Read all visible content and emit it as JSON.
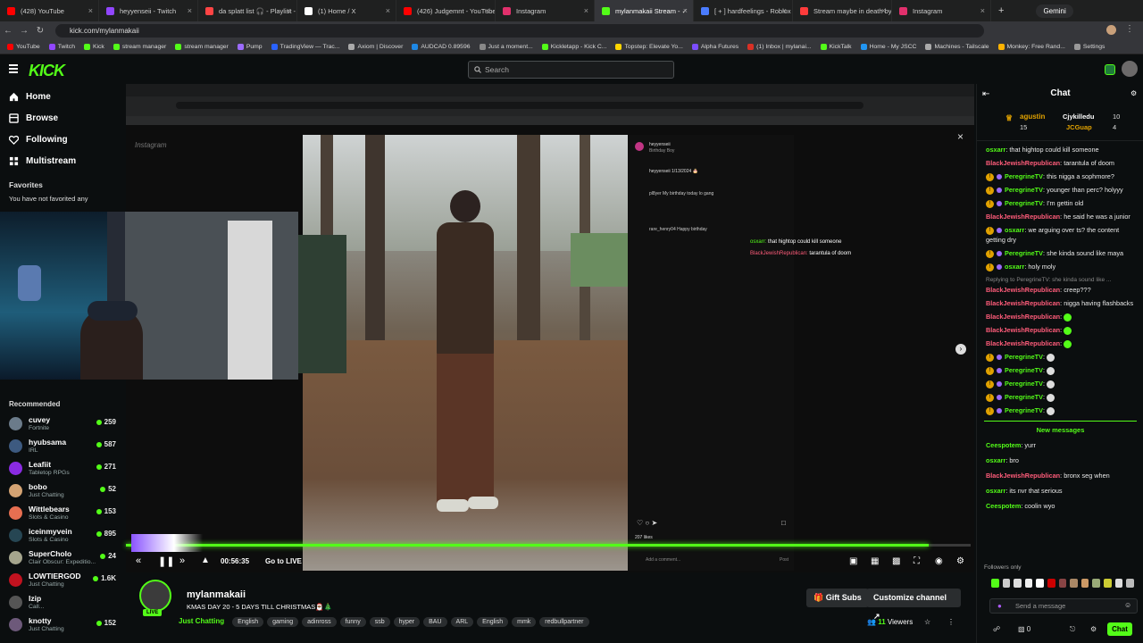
{
  "browser": {
    "tabs": [
      {
        "label": "(428) YouTube",
        "color": "#ff0000"
      },
      {
        "label": "heyyenseii - Twitch",
        "color": "#9146ff"
      },
      {
        "label": "da splatt list 🎧 - Playlist - A",
        "color": "#ff4444"
      },
      {
        "label": "(1) Home / X",
        "color": "#ffffff"
      },
      {
        "label": "(426) Judgemnt - YouTube",
        "color": "#ff0000"
      },
      {
        "label": "Instagram",
        "color": "#e1306c"
      },
      {
        "label": "mylanmakaii Stream - ✓",
        "color": "#53fc18"
      },
      {
        "label": "[ + ] hardfeelings - Roblox",
        "color": "#4a7cff"
      },
      {
        "label": "Stream maybe in death by C",
        "color": "#ff3b3b"
      },
      {
        "label": "Instagram",
        "color": "#e1306c"
      }
    ],
    "active_tab": 6,
    "profile_label": "Gemini",
    "url": "kick.com/mylanmakaii",
    "bookmarks": [
      "YouTube",
      "Twitch",
      "Kick",
      "stream manager",
      "stream manager",
      "Pump",
      "TradingView — Trac...",
      "Axiom | Discover",
      "AUDCAD 0.89596",
      "Just a moment...",
      "Kickletapp - Kick C...",
      "Topstep: Elevate Yo...",
      "Alpha Futures",
      "(1) Inbox | mylanai...",
      "KickTalk",
      "Home - My JSCC",
      "Machines - Tailscale",
      "Monkey: Free Rand...",
      "Settings"
    ]
  },
  "kick": {
    "logo": "KICK",
    "search_placeholder": "Search"
  },
  "sidebar": {
    "nav": [
      {
        "label": "Home",
        "icon": "home-icon"
      },
      {
        "label": "Browse",
        "icon": "browse-icon"
      },
      {
        "label": "Following",
        "icon": "heart-icon"
      },
      {
        "label": "Multistream",
        "icon": "multistream-icon"
      }
    ],
    "favorites_title": "Favorites",
    "favorites_empty": "You have not favorited any",
    "recommended_title": "Recommended",
    "recommended": [
      {
        "name": "cuvey",
        "category": "Fortnite",
        "viewers": "259",
        "color": "#6b7b8a"
      },
      {
        "name": "hyubsama",
        "category": "IRL",
        "viewers": "587",
        "color": "#3d5a80"
      },
      {
        "name": "Leafiit",
        "category": "Tabletop RPGs",
        "viewers": "271",
        "color": "#8a2be2"
      },
      {
        "name": "bobo",
        "category": "Just Chatting",
        "viewers": "52",
        "color": "#d4a373"
      },
      {
        "name": "Wittlebears",
        "category": "Slots & Casino",
        "viewers": "153",
        "color": "#e76f51"
      },
      {
        "name": "iceinmyvein",
        "category": "Slots & Casino",
        "viewers": "895",
        "color": "#264653"
      },
      {
        "name": "SuperChoIo",
        "category": "Clair Obscur: Expeditio...",
        "viewers": "24",
        "color": "#a5a58d"
      },
      {
        "name": "LOWTIERGOD",
        "category": "Just Chatting",
        "viewers": "1.6K",
        "color": "#c1121f"
      },
      {
        "name": "Izip",
        "category": "Call...",
        "viewers": "",
        "color": "#555555"
      },
      {
        "name": "knotty",
        "category": "Just Chatting",
        "viewers": "152",
        "color": "#6d597a"
      }
    ]
  },
  "player": {
    "time": "00:56:35",
    "go_live": "Go to LIVE",
    "progress": 0.95
  },
  "stream_info": {
    "channel": "mylanmakaii",
    "title": "KMAS DAY 20 - 5 DAYS TILL CHRISTMAS🎅🏾🎄",
    "live_badge": "LIVE",
    "category": "Just Chatting",
    "tags": [
      "English",
      "gaming",
      "adinross",
      "funny",
      "ssb",
      "hyper",
      "BAU",
      "ARL",
      "English",
      "mmk",
      "redbullpartner"
    ],
    "viewers": "11",
    "viewers_label": "Viewers",
    "gift_subs": "Gift Subs",
    "customize": "Customize channel"
  },
  "chat": {
    "title": "Chat",
    "top_gifters": [
      {
        "name": "agustin",
        "count": "15"
      },
      {
        "name": "Cjykilledu",
        "count": "10"
      },
      {
        "name": "JCGuap",
        "count": "4"
      }
    ],
    "messages": [
      {
        "user": "osxarr",
        "color": "#53fc18",
        "badge": false,
        "text": "that hightop could kill someone"
      },
      {
        "user": "BlackJewishRepublican",
        "color": "#ff5c7a",
        "badge": false,
        "text": "tarantula of doom"
      },
      {
        "user": "PeregrineTV",
        "color": "#53fc18",
        "badge": true,
        "text": "this nigga a sophmore?"
      },
      {
        "user": "PeregrineTV",
        "color": "#53fc18",
        "badge": true,
        "text": "younger than perc? holyyy"
      },
      {
        "user": "PeregrineTV",
        "color": "#53fc18",
        "badge": true,
        "text": "I'm gettin old"
      },
      {
        "user": "BlackJewishRepublican",
        "color": "#ff5c7a",
        "badge": false,
        "text": "he said he was a junior"
      },
      {
        "user": "osxarr",
        "color": "#53fc18",
        "badge": true,
        "text": "we arguing over ts? the content getting dry"
      },
      {
        "user": "PeregrineTV",
        "color": "#53fc18",
        "badge": true,
        "text": "she kinda sound like maya"
      },
      {
        "user": "osxarr",
        "color": "#53fc18",
        "badge": true,
        "text": "holy moly"
      },
      {
        "user": "BlackJewishRepublican",
        "color": "#ff5c7a",
        "badge": false,
        "text": "creep???",
        "reply": "Replying to PeregrineTV: she kinda sound like ..."
      },
      {
        "user": "BlackJewishRepublican",
        "color": "#ff5c7a",
        "badge": false,
        "text": "nigga having flashbacks"
      },
      {
        "user": "BlackJewishRepublican",
        "color": "#ff5c7a",
        "badge": false,
        "emote": true
      },
      {
        "user": "BlackJewishRepublican",
        "color": "#ff5c7a",
        "badge": false,
        "emote": true
      },
      {
        "user": "BlackJewishRepublican",
        "color": "#ff5c7a",
        "badge": false,
        "emote": true
      },
      {
        "user": "PeregrineTV",
        "color": "#53fc18",
        "badge": true,
        "emote2": true
      },
      {
        "user": "PeregrineTV",
        "color": "#53fc18",
        "badge": true,
        "emote2": true
      },
      {
        "user": "PeregrineTV",
        "color": "#53fc18",
        "badge": true,
        "emote2": true
      },
      {
        "user": "PeregrineTV",
        "color": "#53fc18",
        "badge": true,
        "emote2": true
      },
      {
        "user": "PeregrineTV",
        "color": "#53fc18",
        "badge": true,
        "emote2": true
      }
    ],
    "new_messages_label": "New messages",
    "new_messages": [
      {
        "user": "Ceespotem",
        "color": "#53fc18",
        "text": "yurr"
      },
      {
        "user": "osxarr",
        "color": "#53fc18",
        "text": "bro"
      },
      {
        "user": "BlackJewishRepublican",
        "color": "#ff5c7a",
        "text": "bronx seg when"
      },
      {
        "user": "osxarr",
        "color": "#53fc18",
        "text": "its nvr that serious"
      },
      {
        "user": "Ceespotem",
        "color": "#53fc18",
        "text": "coolin wyo"
      }
    ],
    "followers_only": "Followers only",
    "input_placeholder": "Send a message",
    "points": "0",
    "chat_button": "Chat"
  },
  "overlay": {
    "ig_user": "heyyenseii",
    "ig_sub": "Birthday Boy",
    "ig_caption": "heyyenseii 1/13/2024 🎂",
    "ig_c1": "pl8yer My birthday today lo gang",
    "ig_c2": "rare_henry04 Happy birthday",
    "ig_likes": "207 likes",
    "ig_comment_placeholder": "Add a comment...",
    "ig_post": "Post",
    "overlay_chat": [
      {
        "user": "osxarr",
        "text": "that hightop could kill someone"
      },
      {
        "user": "BlackJewishRepublican",
        "text": "tarantula of doom"
      }
    ]
  }
}
